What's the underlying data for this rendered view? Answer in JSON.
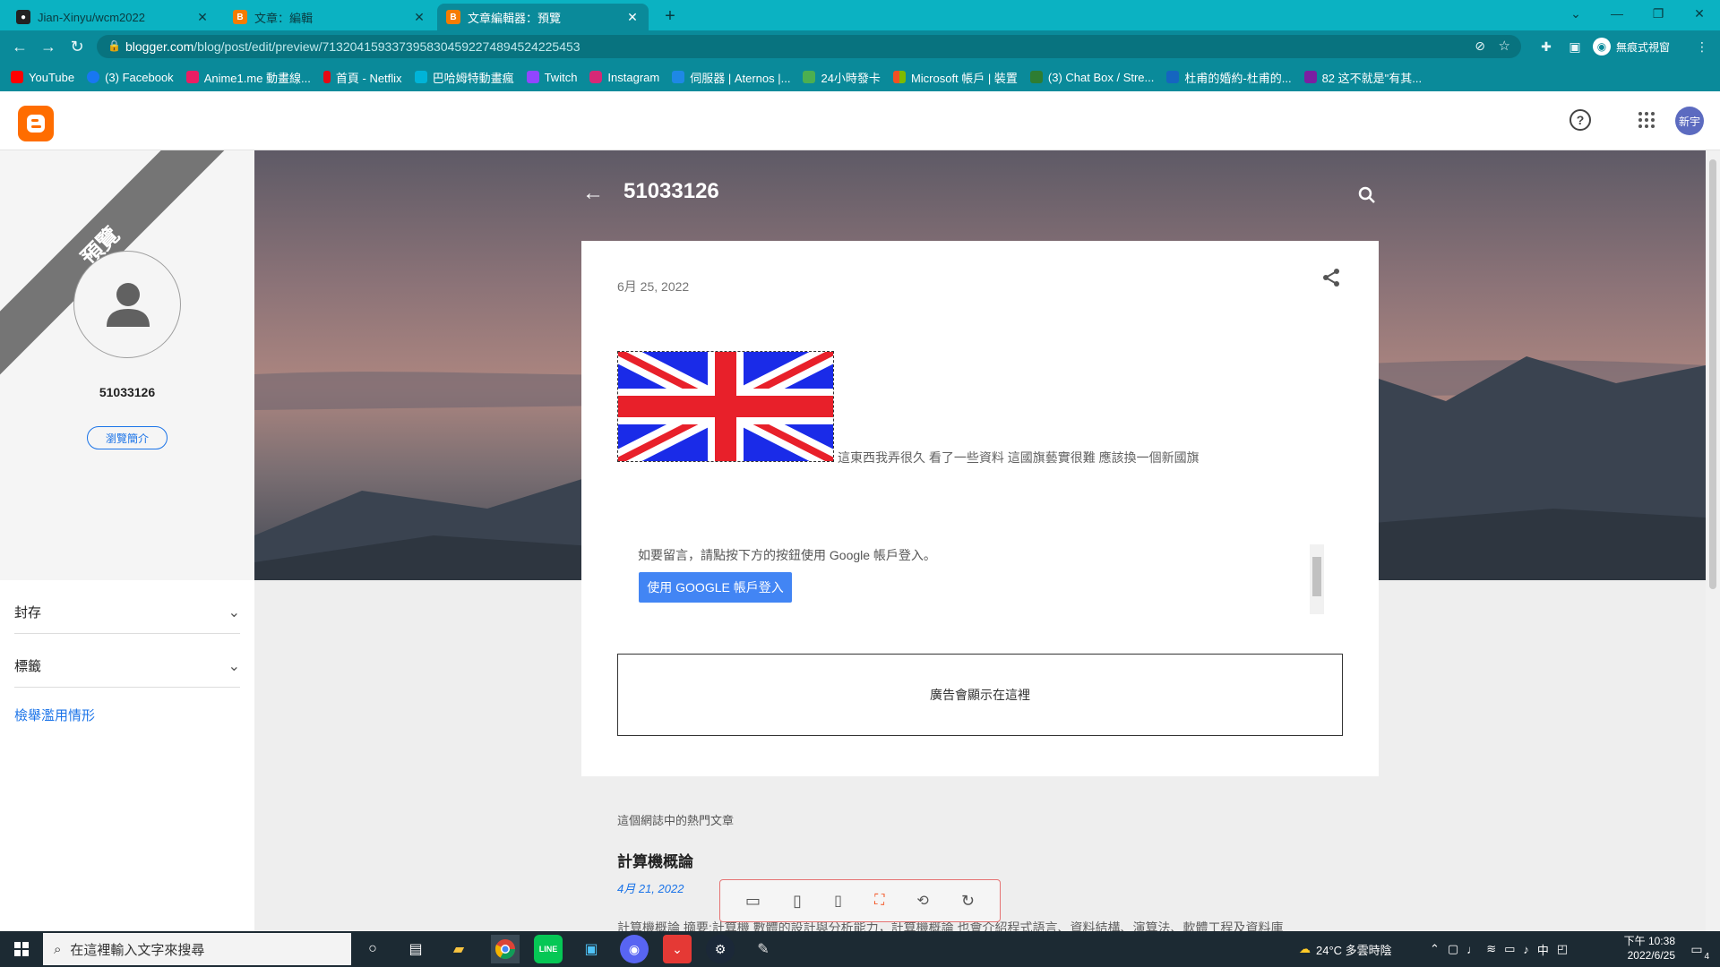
{
  "browser": {
    "tabs": [
      {
        "title": "Jian-Xinyu/wcm2022",
        "icon": "github-icon"
      },
      {
        "title": "文章：編輯",
        "icon": "blogger-icon"
      },
      {
        "title": "文章編輯器：預覽",
        "icon": "blogger-icon"
      }
    ],
    "url_host": "blogger.com",
    "url_path": "/blog/post/edit/preview/7132041593373958304592274894524225453",
    "incognito_label": "無痕式視窗",
    "bookmarks": [
      {
        "label": "YouTube",
        "color": "#ff0000"
      },
      {
        "label": "(3) Facebook",
        "color": "#1877f2"
      },
      {
        "label": "Anime1.me 動畫線...",
        "color": "#e91e63"
      },
      {
        "label": "首頁 - Netflix",
        "color": "#e50914"
      },
      {
        "label": "巴哈姆特動畫瘋",
        "color": "#00b4d8"
      },
      {
        "label": "Twitch",
        "color": "#9146ff"
      },
      {
        "label": "Instagram",
        "color": "#d62976"
      },
      {
        "label": "伺服器 | Aternos |...",
        "color": "#1e88e5"
      },
      {
        "label": "24小時發卡",
        "color": "#4caf50"
      },
      {
        "label": "Microsoft 帳戶 | 裝置",
        "color": "#f25022"
      },
      {
        "label": "(3) Chat Box / Stre...",
        "color": "#2e7d32"
      },
      {
        "label": "杜甫的婚約-杜甫的...",
        "color": "#1565c0"
      },
      {
        "label": "82 这不就是\"有其...",
        "color": "#7b1fa2"
      }
    ]
  },
  "blogger": {
    "avatar_text": "新宇"
  },
  "sidebar": {
    "ribbon": "預覽",
    "profile_name": "51033126",
    "profile_button": "瀏覽簡介",
    "archive": "封存",
    "labels": "標籤",
    "report": "檢舉濫用情形"
  },
  "blog": {
    "title": "51033126",
    "post_date": "6月 25, 2022",
    "post_text": "這東西我弄很久 看了一些資料 這國旗藝實很難 應該換一個新國旗",
    "comment_prompt": "如要留言，請點按下方的按鈕使用 Google 帳戶登入。",
    "google_signin": "使用 GOOGLE 帳戶登入",
    "ad_text": "廣告會顯示在這裡",
    "popular_heading": "這個網誌中的熱門文章",
    "popular_title": "計算機概論",
    "popular_date": "4月 21, 2022",
    "popular_snippet": "計算機概論 摘要:計算機 數體的設計與分析能力，計算機概論 也會介紹程式語言、資料結構、演算法、軟體工程及資料庫"
  },
  "taskbar": {
    "search_placeholder": "在這裡輸入文字來搜尋",
    "weather": "24°C 多雲時陰",
    "ime": "中",
    "time": "下午 10:38",
    "date": "2022/6/25",
    "notif_count": "4"
  }
}
